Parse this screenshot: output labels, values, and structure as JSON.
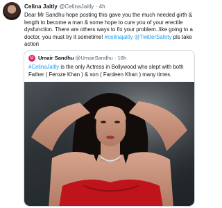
{
  "tweet": {
    "author_name": "Celina Jaitly",
    "author_handle": "@CelinaJaitly",
    "separator": "·",
    "time": "4h",
    "text_main": "Dear Mr Sandhu hope posting this gave you the much needed girth & length to become a man & some hope to cure you of your erectile dysfunction. There are others ways to fix your problem..like going to a doctor, you must try it sometime! ",
    "hashtag_1": "#celinajaitly",
    "mention_1": "@TwitterSafety",
    "text_tail": " pls take action"
  },
  "quoted_tweet": {
    "avatar_letter": "U",
    "author_name": "Umair Sandhu",
    "author_handle": "@UmairSandhu",
    "separator": "·",
    "time": "18h",
    "hashtag": "#CelinaJaitly",
    "text": " is the only Actress in Bollywood who slept with both Father ( Feroze Khan ) & son ( Fardeen Khan ) many times."
  },
  "colors": {
    "link": "#1d9bf0",
    "secondary_text": "#536471",
    "border": "#cfd9de",
    "dress": "#c0141c"
  }
}
